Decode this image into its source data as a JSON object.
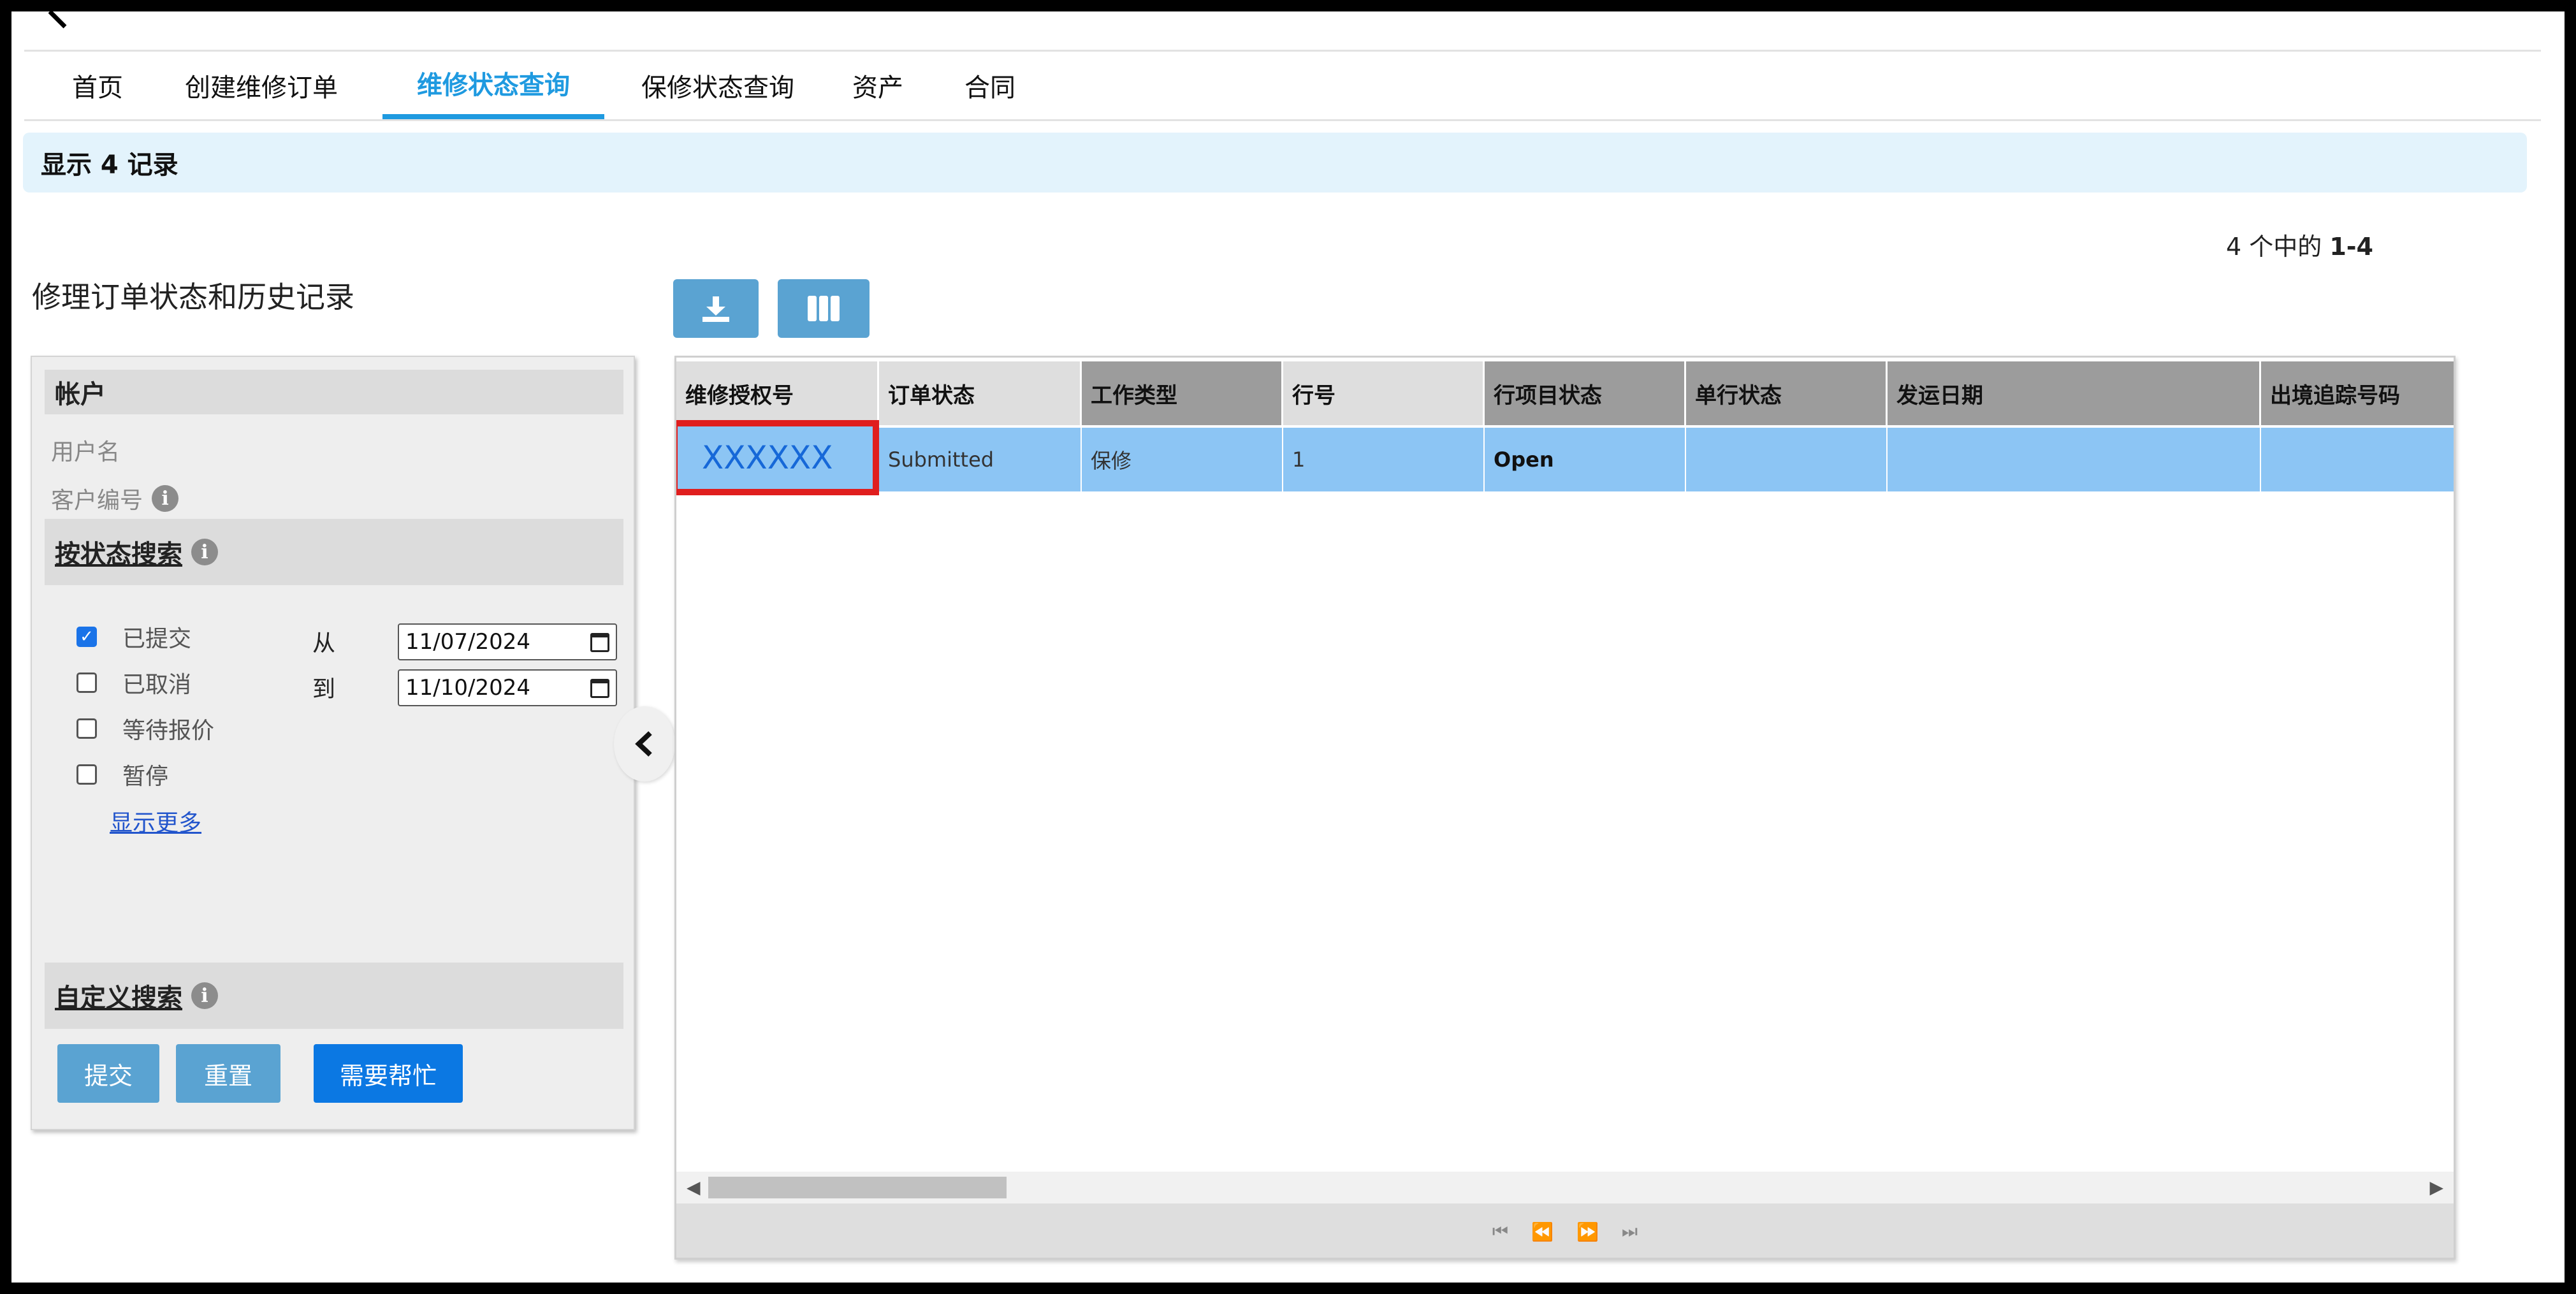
{
  "nav": {
    "tabs": [
      {
        "label": "首页"
      },
      {
        "label": "创建维修订单"
      },
      {
        "label": "维修状态查询",
        "active": true
      },
      {
        "label": "保修状态查询"
      },
      {
        "label": "资产"
      },
      {
        "label": "合同"
      }
    ]
  },
  "banner": {
    "text": "显示 4 记录"
  },
  "pager": {
    "prefix": "4 个中的 ",
    "range": "1-4"
  },
  "section_title": "修理订单状态和历史记录",
  "left_panel": {
    "account_header": "帐户",
    "username_label": "用户名",
    "customer_no_label": "客户编号",
    "status_search_header": "按状态搜索",
    "checkboxes": [
      {
        "label": "已提交",
        "checked": true
      },
      {
        "label": "已取消",
        "checked": false
      },
      {
        "label": "等待报价",
        "checked": false
      },
      {
        "label": "暂停",
        "checked": false
      }
    ],
    "from_label": "从",
    "to_label": "到",
    "from_date": "11/07/2024",
    "to_date": "11/10/2024",
    "show_more": "显示更多",
    "custom_search_header": "自定义搜索",
    "submit_label": "提交",
    "reset_label": "重置",
    "help_label": "需要帮忙"
  },
  "info_icon_glyph": "i",
  "grid": {
    "headers": [
      "维修授权号",
      "订单状态",
      "工作类型",
      "行号",
      "行项目状态",
      "单行状态",
      "发运日期",
      "出境追踪号码"
    ],
    "row": {
      "auth_no": "XXXXXX",
      "order_status": "Submitted",
      "work_type": "保修",
      "line_no": "1",
      "line_item_status": "Open",
      "single_line_status": "",
      "ship_date": "",
      "tracking_no": ""
    }
  },
  "colors": {
    "accent": "#1f9ae0",
    "banner_bg": "#e3f3fc",
    "row_highlight": "#8cc5f4",
    "highlight_box": "#e01e1e",
    "tool_button": "#5aa3d2",
    "help_button": "#0b78e3"
  },
  "icons": {
    "download": "download-icon",
    "columns": "columns-icon",
    "collapse": "chevron-left-icon",
    "calendar": "calendar-icon",
    "info": "info-icon"
  }
}
